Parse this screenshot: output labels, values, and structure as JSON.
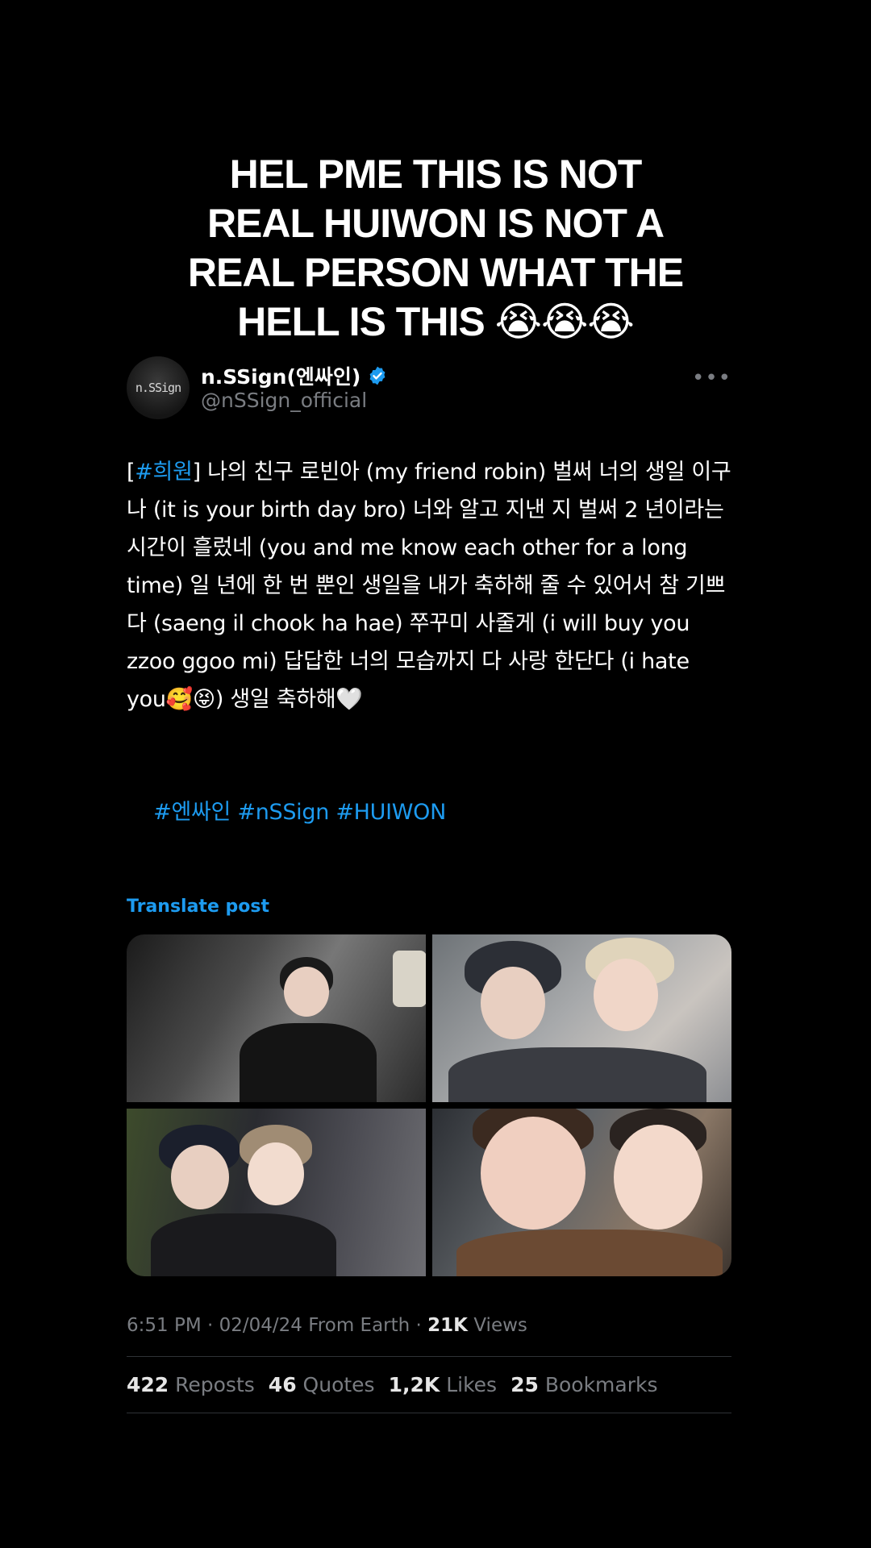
{
  "caption": {
    "line1": "HEL PME THIS IS NOT",
    "line2": "REAL HUIWON IS NOT A",
    "line3": "REAL PERSON WHAT THE",
    "line4": "HELL IS THIS 😭😭😭"
  },
  "post": {
    "avatar_text": "n.SSign",
    "display_name": "n.SSign(엔싸인)",
    "handle": "@nSSign_official",
    "more": "•••",
    "hashtag_open": "[",
    "hashtag": "#희원",
    "body_text": "] 나의 친구 로빈아 (my friend robin) 벌써 너의 생일 이구나 (it is your birth day bro) 너와 알고 지낸 지 벌써 2 년이라는 시간이 흘렀네 (you and me know each other for a long time) 일 년에 한 번 뿐인 생일을 내가 축하해 줄 수 있어서 참 기쁘다 (saeng il chook ha hae) 쭈꾸미 사줄게 (i will buy you zzoo ggoo mi) 답답한 너의 모습까지 다 사랑 한단다 (i hate you🥰😝) 생일 축하해🤍",
    "tags": "#엔싸인 #nSSign #HUIWON",
    "translate": "Translate post",
    "time": "6:51 PM",
    "date": "02/04/24",
    "source": "From Earth",
    "views_count": "21K",
    "views_label": "Views",
    "stats": [
      {
        "count": "422",
        "label": "Reposts"
      },
      {
        "count": "46",
        "label": "Quotes"
      },
      {
        "count": "1,2K",
        "label": "Likes"
      },
      {
        "count": "25",
        "label": "Bookmarks"
      }
    ]
  },
  "colors": {
    "background": "#000000",
    "link": "#1d9bf0",
    "muted": "#7a7d82",
    "verified": "#1d9bf0"
  }
}
